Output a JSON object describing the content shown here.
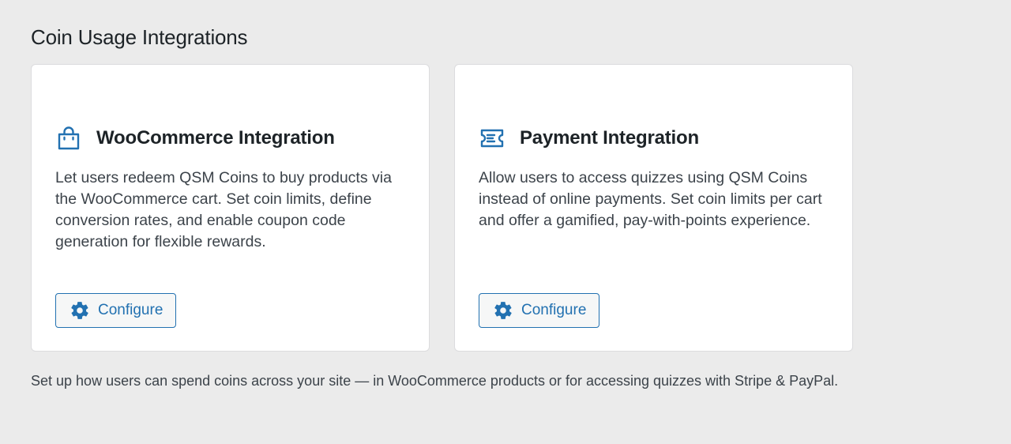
{
  "page": {
    "title": "Coin Usage Integrations",
    "footer_note": "Set up how users can spend coins across your site — in WooCommerce products or for accessing quizzes with Stripe & PayPal."
  },
  "cards": [
    {
      "icon": "shopping-bag-icon",
      "title": "WooCommerce Integration",
      "description": "Let users redeem QSM Coins to buy products via the WooCommerce cart. Set coin limits, define conversion rates, and enable coupon code generation for flexible rewards.",
      "button_label": "Configure"
    },
    {
      "icon": "ticket-icon",
      "title": "Payment Integration",
      "description": "Allow users to access quizzes using QSM Coins instead of online payments. Set coin limits per cart and offer a gamified, pay-with-points experience.",
      "button_label": "Configure"
    }
  ],
  "colors": {
    "accent": "#2271b1",
    "background": "#ebebeb",
    "card": "#ffffff"
  }
}
